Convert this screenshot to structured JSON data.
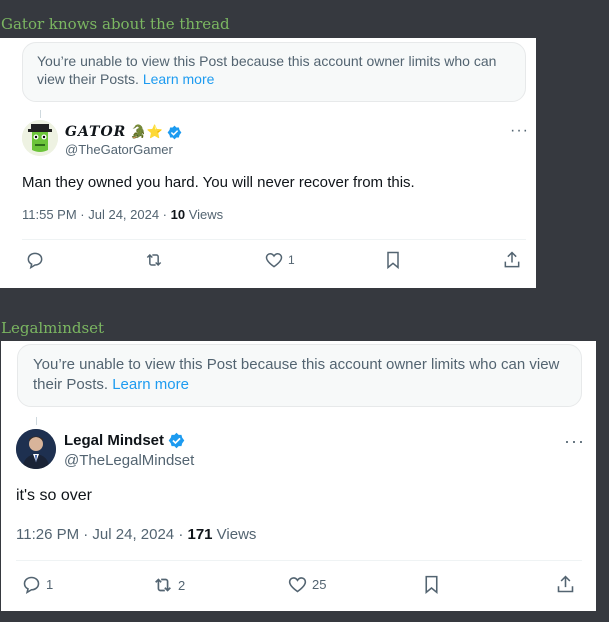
{
  "sections": [
    {
      "title": "Gator knows about the thread",
      "notice": {
        "text": "You’re unable to view this Post because this account owner limits who can view their Posts.",
        "link": "Learn more"
      },
      "author": {
        "name": "GATOR",
        "handle": "@TheGatorGamer",
        "name_emoji": "🐊⭐"
      },
      "text": "Man they owned you hard. You will never recover from this.",
      "time": "11:55 PM · Jul 24, 2024 · ",
      "views_count": "10",
      "views_label": " Views",
      "reply_count": "",
      "repost_count": "",
      "like_count": "1"
    },
    {
      "title": "Legalmindset",
      "notice": {
        "text": "You’re unable to view this Post because this account owner limits who can view their Posts.",
        "link": "Learn more"
      },
      "author": {
        "name": "Legal Mindset",
        "handle": "@TheLegalMindset"
      },
      "text": "it's so over",
      "time": "11:26 PM · Jul 24, 2024 · ",
      "views_count": "171",
      "views_label": " Views",
      "reply_count": "1",
      "repost_count": "2",
      "like_count": "25"
    }
  ],
  "colors": {
    "background": "#36393f",
    "title": "#7bb661",
    "link": "#1d9bf0",
    "verified": "#1d9bf0",
    "muted": "#536471"
  },
  "icons": [
    "reply-icon",
    "repost-icon",
    "like-icon",
    "bookmark-icon",
    "share-icon",
    "verified-icon",
    "more-icon"
  ]
}
